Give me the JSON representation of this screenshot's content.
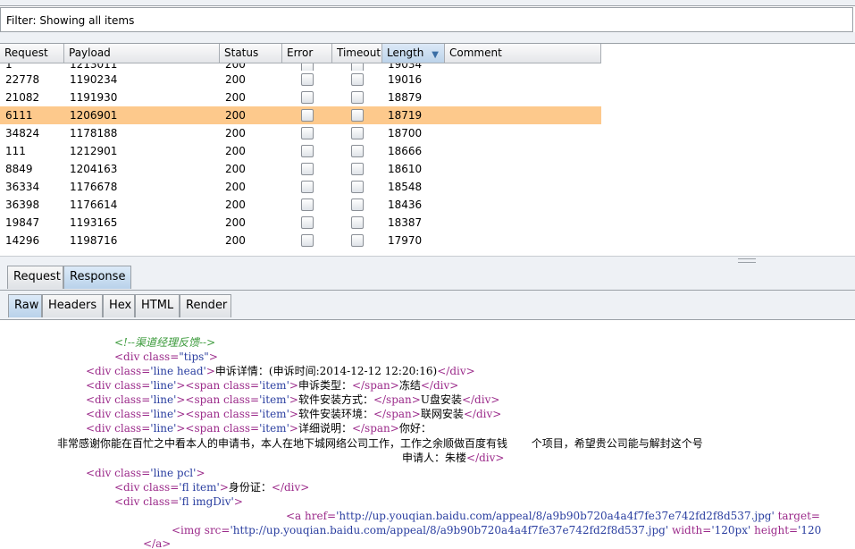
{
  "filter": {
    "text": "Filter: Showing all items"
  },
  "table": {
    "columns": [
      "Request",
      "Payload",
      "Status",
      "Error",
      "Timeout",
      "Length",
      "Comment"
    ],
    "sorted_column": "Length",
    "partial_top_row": {
      "request": "1",
      "payload": "1213011",
      "status": "200",
      "length": "19034"
    },
    "rows": [
      {
        "request": "22778",
        "payload": "1190234",
        "status": "200",
        "length": "19016",
        "selected": false
      },
      {
        "request": "21082",
        "payload": "1191930",
        "status": "200",
        "length": "18879",
        "selected": false
      },
      {
        "request": "6111",
        "payload": "1206901",
        "status": "200",
        "length": "18719",
        "selected": true
      },
      {
        "request": "34824",
        "payload": "1178188",
        "status": "200",
        "length": "18700",
        "selected": false
      },
      {
        "request": "111",
        "payload": "1212901",
        "status": "200",
        "length": "18666",
        "selected": false
      },
      {
        "request": "8849",
        "payload": "1204163",
        "status": "200",
        "length": "18610",
        "selected": false
      },
      {
        "request": "36334",
        "payload": "1176678",
        "status": "200",
        "length": "18548",
        "selected": false
      },
      {
        "request": "36398",
        "payload": "1176614",
        "status": "200",
        "length": "18436",
        "selected": false
      },
      {
        "request": "19847",
        "payload": "1193165",
        "status": "200",
        "length": "18387",
        "selected": false
      },
      {
        "request": "14296",
        "payload": "1198716",
        "status": "200",
        "length": "17970",
        "selected": false
      }
    ]
  },
  "tabs_main": {
    "request": "Request",
    "response": "Response"
  },
  "tabs_view": {
    "raw": "Raw",
    "headers": "Headers",
    "hex": "Hex",
    "html": "HTML",
    "render": "Render"
  },
  "code": {
    "l1": "<!--渠道经理反馈-->",
    "l2_open": "<div ",
    "l2_attr": "class=",
    "l2_val": "\"tips\"",
    "l2_close": ">",
    "l3": {
      "a": "<div ",
      "b": "class=",
      "c": "'line head'",
      "d": ">",
      "text": "申诉详情：(申诉时间:2014-12-12 12:20:16)",
      "e": "</div>"
    },
    "l4": {
      "a": "<div ",
      "b": "class=",
      "c": "'line'",
      "d": "><span ",
      "e": "class=",
      "f": "'item'",
      "g": ">",
      "label": "申诉类型：",
      "h": "</span>",
      "value": "冻结",
      "i": "</div>"
    },
    "l5": {
      "a": "<div ",
      "b": "class=",
      "c": "'line'",
      "d": "><span ",
      "e": "class=",
      "f": "'item'",
      "g": ">",
      "label": "软件安装方式：",
      "h": "</span>",
      "value": "U盘安装",
      "i": "</div>"
    },
    "l6": {
      "a": "<div ",
      "b": "class=",
      "c": "'line'",
      "d": "><span ",
      "e": "class=",
      "f": "'item'",
      "g": ">",
      "label": "软件安装环境：",
      "h": "</span>",
      "value": "联网安装",
      "i": "</div>"
    },
    "l7": {
      "a": "<div ",
      "b": "class=",
      "c": "'line'",
      "d": "><span ",
      "e": "class=",
      "f": "'item'",
      "g": ">",
      "label": "详细说明：",
      "h": "</span>",
      "value": "你好："
    },
    "l8": "非常感谢你能在百忙之中看本人的申请书，本人在地下城网络公司工作，工作之余顺做百度有钱       个项目，希望贵公司能与解封这个号",
    "l9": {
      "text": "申请人：朱楼",
      "close": "</div>"
    },
    "l10": {
      "a": "<div ",
      "b": "class=",
      "c": "'line pcl'",
      "d": ">"
    },
    "l11": {
      "a": "<div ",
      "b": "class=",
      "c": "'fl item'",
      "d": ">",
      "text": "身份证：",
      "e": "</div>"
    },
    "l12": {
      "a": "<div ",
      "b": "class=",
      "c": "'fl imgDiv'",
      "d": ">"
    },
    "l13": {
      "a": "<a ",
      "b": "href=",
      "c": "'http://up.youqian.baidu.com/appeal/8/a9b90b720a4a4f7fe37e742fd2f8d537.jpg'",
      "d": " target="
    },
    "l14": {
      "a": "<img ",
      "b": "src=",
      "c": "'http://up.youqian.baidu.com/appeal/8/a9b90b720a4a4f7fe37e742fd2f8d537.jpg'",
      "d": " width=",
      "e": "'120px'",
      "f": " height=",
      "g": "'120"
    },
    "l15": "</a>"
  }
}
